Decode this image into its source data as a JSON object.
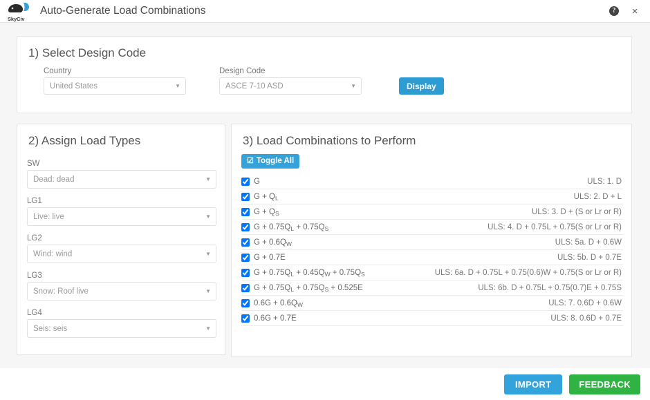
{
  "header": {
    "logo_text": "SkyCiv",
    "title": "Auto-Generate Load Combinations",
    "help_glyph": "?",
    "close_glyph": "×"
  },
  "design_code_panel": {
    "title": "1) Select Design Code",
    "country_label": "Country",
    "country_value": "United States",
    "design_code_label": "Design Code",
    "design_code_value": "ASCE 7-10 ASD",
    "display_button": "Display",
    "caret_glyph": "▼"
  },
  "load_types_panel": {
    "title": "2) Assign Load Types",
    "fields": [
      {
        "label": "SW",
        "value": "Dead: dead"
      },
      {
        "label": "LG1",
        "value": "Live: live"
      },
      {
        "label": "LG2",
        "value": "Wind: wind"
      },
      {
        "label": "LG3",
        "value": "Snow: Roof live"
      },
      {
        "label": "LG4",
        "value": "Seis: seis"
      }
    ]
  },
  "load_combos_panel": {
    "title": "3) Load Combinations to Perform",
    "toggle_all_label": "Toggle All",
    "toggle_all_icon": "☑",
    "rows": [
      {
        "checked": true,
        "expr_html": "G",
        "desc": "ULS: 1. D"
      },
      {
        "checked": true,
        "expr_html": "G + Q<sub>L</sub>",
        "desc": "ULS: 2. D + L"
      },
      {
        "checked": true,
        "expr_html": "G + Q<sub>S</sub>",
        "desc": "ULS: 3. D + (S or Lr or R)"
      },
      {
        "checked": true,
        "expr_html": "G + 0.75Q<sub>L</sub> + 0.75Q<sub>S</sub>",
        "desc": "ULS: 4. D + 0.75L + 0.75(S or Lr or R)"
      },
      {
        "checked": true,
        "expr_html": "G + 0.6Q<sub>W</sub>",
        "desc": "ULS: 5a. D + 0.6W"
      },
      {
        "checked": true,
        "expr_html": "G + 0.7E",
        "desc": "ULS: 5b. D + 0.7E"
      },
      {
        "checked": true,
        "expr_html": "G + 0.75Q<sub>L</sub> + 0.45Q<sub>W</sub> + 0.75Q<sub>S</sub>",
        "desc": "ULS: 6a. D + 0.75L + 0.75(0.6)W + 0.75(S or Lr or R)"
      },
      {
        "checked": true,
        "expr_html": "G + 0.75Q<sub>L</sub> + 0.75Q<sub>S</sub> + 0.525E",
        "desc": "ULS: 6b. D + 0.75L + 0.75(0.7)E + 0.75S"
      },
      {
        "checked": true,
        "expr_html": "0.6G + 0.6Q<sub>W</sub>",
        "desc": "ULS: 7. 0.6D + 0.6W"
      },
      {
        "checked": true,
        "expr_html": "0.6G + 0.7E",
        "desc": "ULS: 8. 0.6D + 0.7E"
      }
    ]
  },
  "footer": {
    "import_label": "IMPORT",
    "feedback_label": "FEEDBACK"
  },
  "colors": {
    "accent_blue": "#33a3dc",
    "display_blue": "#2d9cd2",
    "feedback_green": "#2fb444",
    "body_bg": "#f6f6f6"
  }
}
